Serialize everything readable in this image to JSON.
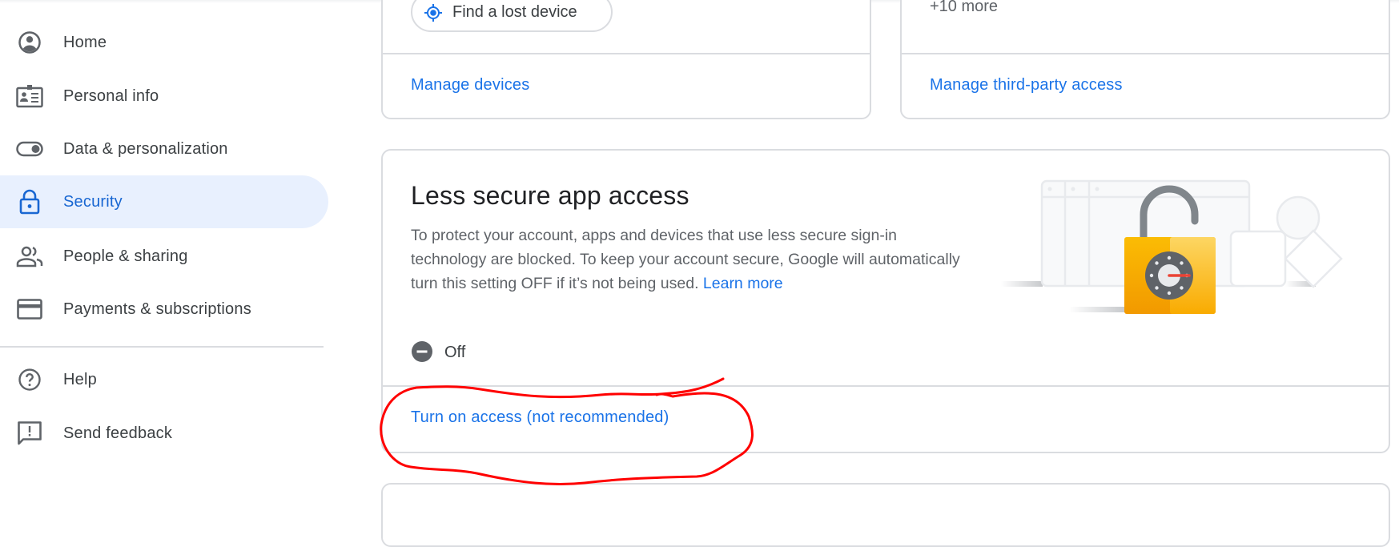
{
  "sidebar": {
    "items": [
      {
        "label": "Home",
        "icon": "account-circle-icon",
        "active": false
      },
      {
        "label": "Personal info",
        "icon": "id-card-icon",
        "active": false
      },
      {
        "label": "Data & personalization",
        "icon": "toggle-icon",
        "active": false
      },
      {
        "label": "Security",
        "icon": "lock-icon",
        "active": true
      },
      {
        "label": "People & sharing",
        "icon": "people-icon",
        "active": false
      },
      {
        "label": "Payments & subscriptions",
        "icon": "credit-card-icon",
        "active": false
      }
    ],
    "secondary": [
      {
        "label": "Help",
        "icon": "help-circle-icon"
      },
      {
        "label": "Send feedback",
        "icon": "feedback-icon"
      }
    ]
  },
  "devices_card": {
    "find_device_label": "Find a lost device",
    "manage_link": "Manage devices"
  },
  "third_party_card": {
    "more_text": "+10 more",
    "manage_link": "Manage third-party access"
  },
  "less_secure_card": {
    "title": "Less secure app access",
    "description": "To protect your account, apps and devices that use less secure sign-in technology are blocked. To keep your account secure, Google will automatically turn this setting OFF if it’s not being used.",
    "learn_more": "Learn more",
    "status_text": "Off",
    "action_link": "Turn on access (not recommended)"
  },
  "colors": {
    "accent": "#1a73e8",
    "active_bg": "#e8f0fe",
    "annotation": "#ff0000",
    "lock_yellow": "#fbbc04"
  }
}
